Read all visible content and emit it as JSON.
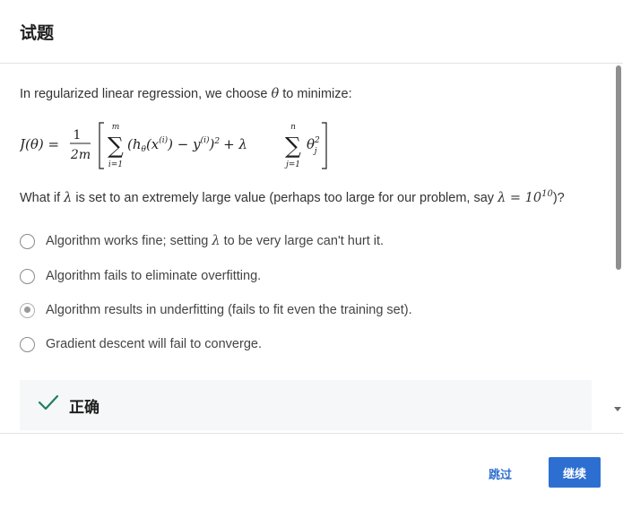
{
  "header": {
    "title": "试题"
  },
  "question": {
    "prompt_before": "In regularized linear regression, we choose ",
    "prompt_theta": "θ",
    "prompt_after": " to minimize:",
    "formula": {
      "lhs": "J(θ) =",
      "frac_num": "1",
      "frac_den": "2m",
      "sum1_top": "m",
      "sum1_bottom": "i=1",
      "sum1_body": "(h",
      "theta_sub": "θ",
      "sum1_body2": "(x",
      "sup_i": "(i)",
      "sum1_body3": ") − y",
      "sup_i2": "(i)",
      "sum1_body4": ")",
      "sq": "2",
      "plus_lambda": "+ λ",
      "sum2_top": "n",
      "sum2_bottom": "j=1",
      "theta_j": "θ",
      "sq2": "2",
      "sub_j": "j"
    },
    "text_before": "What if ",
    "lambda": "λ",
    "text_middle": " is set to an extremely large value (perhaps too large for our problem, say ",
    "lambda2": "λ",
    "equals_exp": " = 10",
    "exp": "10",
    "text_after": ")?"
  },
  "options": [
    {
      "label_before": "Algorithm works fine; setting ",
      "label_lambda": "λ",
      "label_after": " to be very large can't hurt it.",
      "checked": false
    },
    {
      "label": "Algorithm fails to eliminate overfitting.",
      "checked": false
    },
    {
      "label": "Algorithm results in underfitting (fails to fit even the training set).",
      "checked": true
    },
    {
      "label": "Gradient descent will fail to converge.",
      "checked": false
    }
  ],
  "feedback": {
    "text": "正确",
    "status_color": "#1e7f5c"
  },
  "footer": {
    "skip_label": "跳过",
    "continue_label": "继续"
  },
  "colors": {
    "accent": "#2d6fd1",
    "link": "#2f6fd0"
  }
}
